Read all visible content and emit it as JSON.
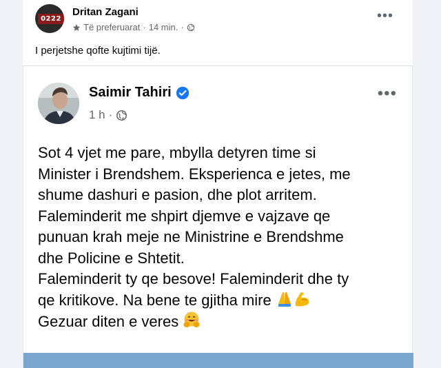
{
  "outer_post": {
    "author": "Dritan Zagani",
    "avatar_plate": "0222",
    "audience": "Të preferuarat",
    "separator": "·",
    "time": "14 min.",
    "separator2": "·",
    "text": "I perjetshe qofte kujtimi tijë."
  },
  "shared_post": {
    "author": "Saimir Tahiri",
    "time": "1 h",
    "separator": "·",
    "lines": [
      "Sot 4 vjet me pare, mbylla detyren time si",
      "Minister i Brendshem. Eksperienca e jetes, me",
      "shume dashuri e pasion, dhe plot arritem.",
      "Faleminderit me shpirt djemve e vajzave qe",
      "punuan krah meje ne Ministrine e Brendshme",
      "dhe Policine e Shtetit.",
      "Faleminderit ty qe besove! Faleminderit dhe ty",
      "qe kritikove. Na bene te gjitha mire",
      "Gezuar diten e veres"
    ]
  },
  "colors": {
    "verified": "#1877f2",
    "meta": "#65676b",
    "background": "#f0f2f5"
  },
  "icons": {
    "audience": "star-icon",
    "privacy": "globe-icon",
    "menu": "more-options-icon",
    "verified": "verified-badge-icon",
    "emoji_1": "folded-hands-icon",
    "emoji_2": "flexed-biceps-icon",
    "emoji_3": "smiling-face-with-open-hands-icon"
  }
}
